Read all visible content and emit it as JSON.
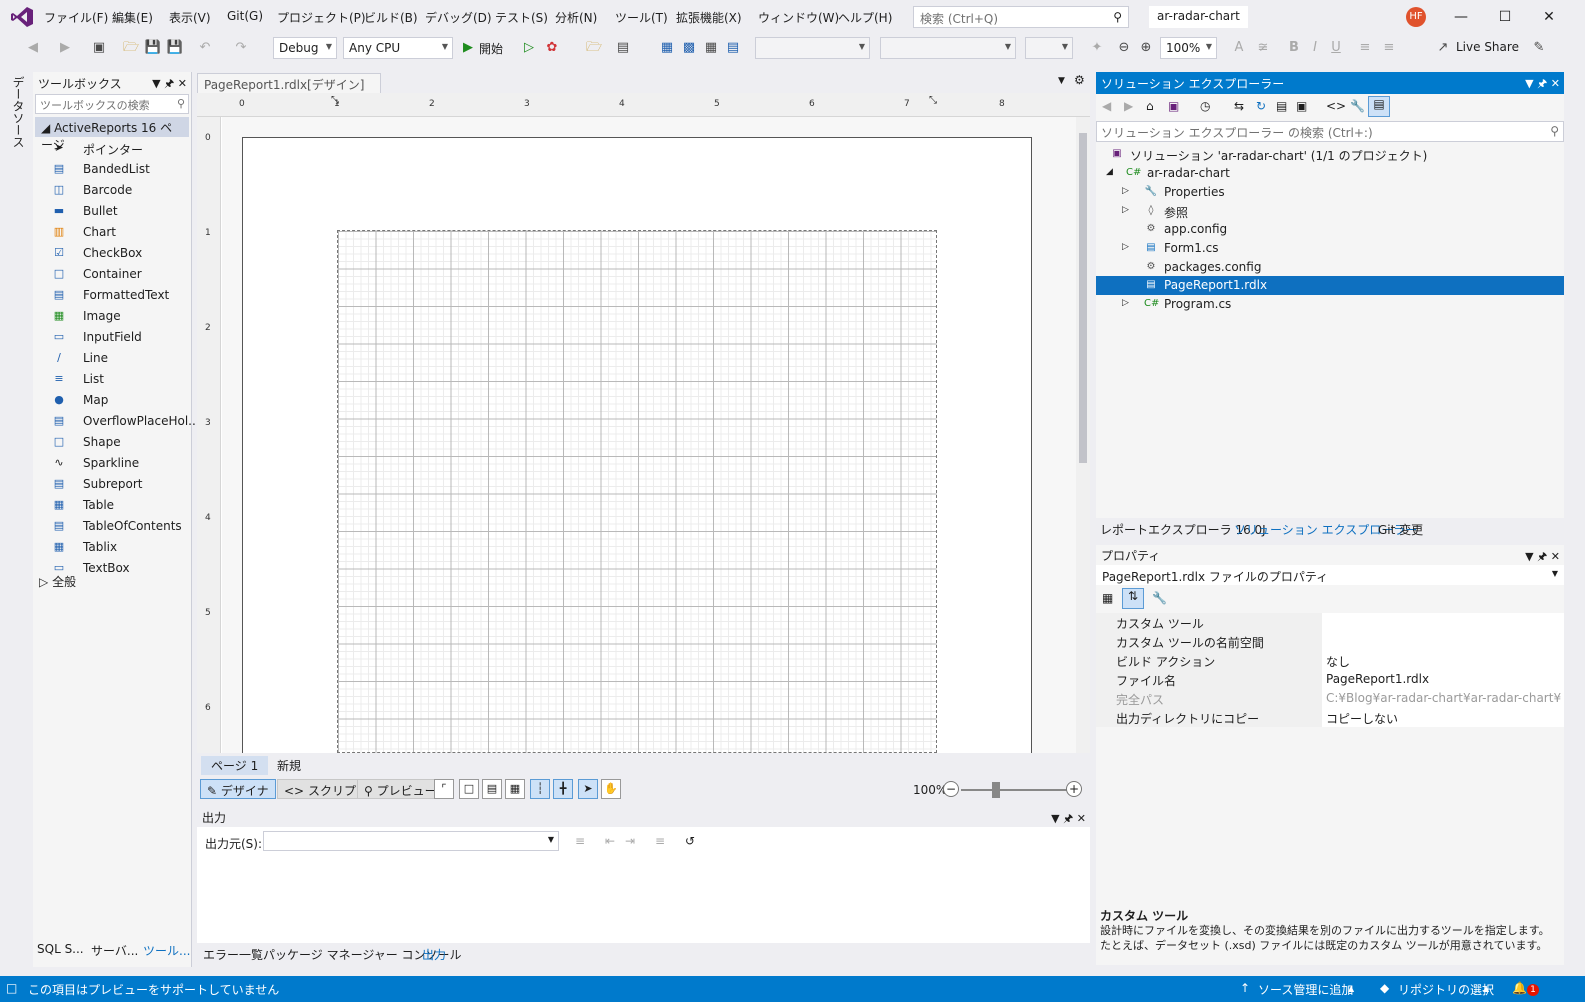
{
  "app": {
    "menu": [
      "ファイル(F)",
      "編集(E)",
      "表示(V)",
      "Git(G)",
      "プロジェクト(P)",
      "ビルド(B)",
      "デバッグ(D)",
      "テスト(S)",
      "分析(N)",
      "ツール(T)",
      "拡張機能(X)",
      "ウィンドウ(W)",
      "ヘルプ(H)"
    ],
    "search_placeholder": "検索 (Ctrl+Q)",
    "solution_name": "ar-radar-chart",
    "avatar_initials": "HF",
    "accent_color": "#007acc"
  },
  "toolbar": {
    "config": "Debug",
    "platform": "Any CPU",
    "start_label": "開始",
    "zoom": "100%",
    "live_share": "Live Share"
  },
  "left_rail": {
    "data_source_tab": "データソース"
  },
  "toolbox": {
    "title": "ツールボックス",
    "search_placeholder": "ツールボックスの検索",
    "group": "ActiveReports 16 ページ",
    "items": [
      "ポインター",
      "BandedList",
      "Barcode",
      "Bullet",
      "Chart",
      "CheckBox",
      "Container",
      "FormattedText",
      "Image",
      "InputField",
      "Line",
      "List",
      "Map",
      "OverflowPlaceHol...",
      "Shape",
      "Sparkline",
      "Subreport",
      "Table",
      "TableOfContents",
      "Tablix",
      "TextBox"
    ],
    "general_group": "全般",
    "bottom_tabs": [
      "SQL S...",
      "サーバ...",
      "ツール..."
    ]
  },
  "designer": {
    "tab_label": "PageReport1.rdlx[デザイン]",
    "ruler_h": [
      "0",
      "1",
      "2",
      "3",
      "4",
      "5",
      "6",
      "7",
      "8"
    ],
    "ruler_v": [
      "0",
      "1",
      "2",
      "3",
      "4",
      "5",
      "6"
    ],
    "page_tabs": [
      "ページ 1",
      "新規"
    ],
    "mode_buttons": [
      "デザイナ",
      "スクリプト",
      "プレビュー"
    ],
    "zoom_label": "100%"
  },
  "output": {
    "title": "出力",
    "source_label": "出力元(S):",
    "bottom_tabs": [
      "エラー一覧",
      "パッケージ マネージャー コンソール",
      "出力"
    ]
  },
  "solution_explorer": {
    "title": "ソリューション エクスプローラー",
    "search_placeholder": "ソリューション エクスプローラー の検索 (Ctrl+:)",
    "tree": [
      {
        "label": "ソリューション 'ar-radar-chart' (1/1 のプロジェクト)",
        "icon": "solution-icon"
      },
      {
        "label": "ar-radar-chart",
        "icon": "csharp-project-icon"
      },
      {
        "label": "Properties",
        "icon": "wrench-icon"
      },
      {
        "label": "参照",
        "icon": "references-icon"
      },
      {
        "label": "app.config",
        "icon": "config-file-icon"
      },
      {
        "label": "Form1.cs",
        "icon": "form-icon"
      },
      {
        "label": "packages.config",
        "icon": "config-file-icon"
      },
      {
        "label": "PageReport1.rdlx",
        "icon": "report-file-icon"
      },
      {
        "label": "Program.cs",
        "icon": "csharp-file-icon"
      }
    ],
    "bottom_tabs": [
      "レポートエクスプローラ 16.0J",
      "ソリューション エクスプローラー",
      "Git 変更"
    ]
  },
  "properties": {
    "title": "プロパティ",
    "object": "PageReport1.rdlx  ファイルのプロパティ",
    "rows": [
      {
        "key": "カスタム ツール",
        "value": ""
      },
      {
        "key": "カスタム ツールの名前空間",
        "value": ""
      },
      {
        "key": "ビルド アクション",
        "value": "なし"
      },
      {
        "key": "ファイル名",
        "value": "PageReport1.rdlx"
      },
      {
        "key": "完全パス",
        "value": "C:¥Blog¥ar-radar-chart¥ar-radar-chart¥PageR"
      },
      {
        "key": "出力ディレクトリにコピー",
        "value": "コピーしない"
      }
    ],
    "desc_title": "カスタム ツール",
    "desc_text": "設計時にファイルを変換し、その変換結果を別のファイルに出力するツールを指定します。たとえば、データセット (.xsd) ファイルには既定のカスタム ツールが用意されています。"
  },
  "statusbar": {
    "left": "この項目はプレビューをサポートしていません",
    "source_control": "ソース管理に追加",
    "repo": "リポジトリの選択",
    "notifications": "1"
  }
}
